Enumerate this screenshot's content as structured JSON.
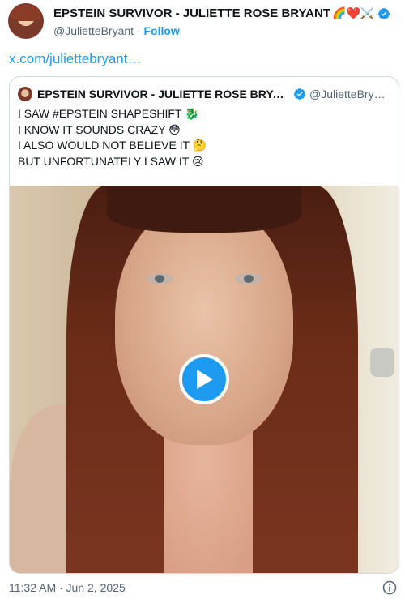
{
  "author": {
    "name": "EPSTEIN SURVIVOR - JULIETTE ROSE BRYANT",
    "name_emojis": "🌈❤️⚔️",
    "handle": "@JulietteBryant",
    "separator": "·",
    "follow_label": "Follow"
  },
  "tweet": {
    "link_text": "x.com/juliettebryant…",
    "timestamp": "11:32 AM · Jun 2, 2025"
  },
  "quoted": {
    "name": "EPSTEIN SURVIVOR - JULIETTE ROSE BRYANT…",
    "handle": "@JulietteBry…",
    "lines": [
      {
        "text": "I SAW #EPSTEIN SHAPESHIFT",
        "emoji": "🐉"
      },
      {
        "text": "I KNOW IT SOUNDS CRAZY",
        "emoji": "😳"
      },
      {
        "text": "I ALSO WOULD NOT BELIEVE IT",
        "emoji": "🤔"
      },
      {
        "text": "BUT UNFORTUNATELY I SAW IT",
        "emoji": "😢"
      }
    ]
  },
  "colors": {
    "accent": "#1d9bf0",
    "text": "#0f1419",
    "secondary": "#536471",
    "border": "#cfd9de"
  },
  "icons": [
    "verified-badge-icon",
    "play-icon",
    "info-icon"
  ]
}
